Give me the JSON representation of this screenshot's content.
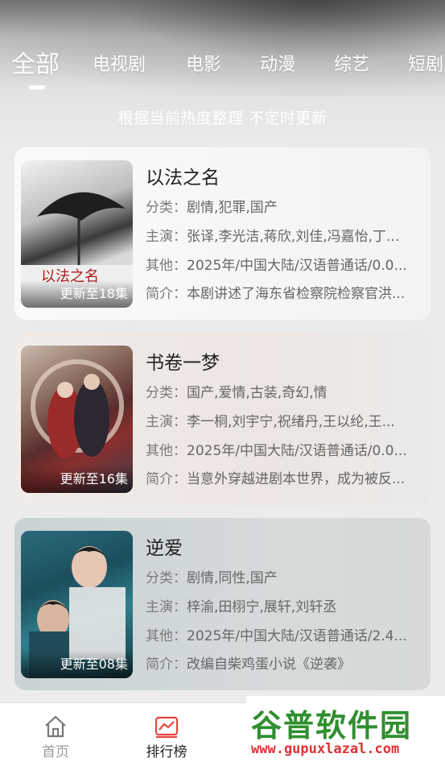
{
  "tabs": [
    "全部",
    "电视剧",
    "电影",
    "动漫",
    "综艺",
    "短剧"
  ],
  "subtitle": "根据当前热度整理 不定时更新",
  "labels": {
    "category": "分类：",
    "cast": "主演：",
    "other": "其他：",
    "intro": "简介："
  },
  "items": [
    {
      "title": "以法之名",
      "update": "更新至18集",
      "category": "剧情,犯罪,国产",
      "cast": "张译,李光洁,蒋欣,刘佳,冯嘉怡,丁...",
      "other": "2025年/中国大陆/汉语普通话/0.0...",
      "intro": "本剧讲述了海东省检察院检察官洪..."
    },
    {
      "title": "书卷一梦",
      "update": "更新至16集",
      "category": "国产,爱情,古装,奇幻,情",
      "cast": "李一桐,刘宇宁,祝绪丹,王以纶,王...",
      "other": "2025年/中国大陆/汉语普通话/0.0...",
      "intro": "当意外穿越进剧本世界，成为被反..."
    },
    {
      "title": "逆爱",
      "update": "更新至08集",
      "category": "剧情,同性,国产",
      "cast": "梓渝,田栩宁,展轩,刘轩丞",
      "other": "2025年/中国大陆/汉语普通话/2.4...",
      "intro": "改编自柴鸡蛋小说《逆袭》"
    }
  ],
  "bottom_nav": {
    "home": "首页",
    "rank": "排行榜"
  },
  "watermark": {
    "name": "谷普软件园",
    "url": "www.gupuxlazal.com"
  },
  "colors": {
    "accent": "#e8453c",
    "active_text": "#222222",
    "inactive_text": "#999999"
  }
}
